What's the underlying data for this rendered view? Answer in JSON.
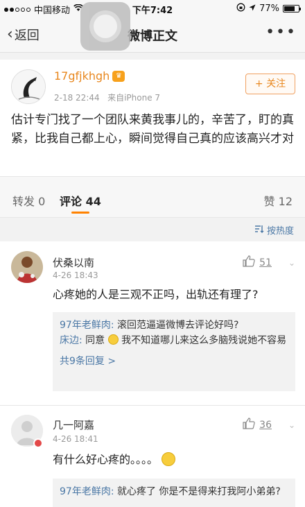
{
  "status_bar": {
    "carrier": "中国移动",
    "time": "下午7:42",
    "battery": "77%",
    "battery_level": 0.77
  },
  "nav": {
    "back_label": "返回",
    "title": "微博正文",
    "more_label": "•••"
  },
  "post": {
    "username": "17gfjkhgh",
    "time": "2-18 22:44",
    "source": "来自iPhone 7",
    "follow_label": "+ 关注",
    "content": "估计专门找了一个团队来黄我事儿的，辛苦了，盯的真紧，比我自己都上心，瞬间觉得自己真的应该高兴才对"
  },
  "tabs": {
    "repost": "转发 0",
    "comments": "评论 44",
    "likes": "赞 12"
  },
  "sort_label": "按热度",
  "comments": [
    {
      "name": "伏桑以南",
      "time": "4-26 18:43",
      "likes": "51",
      "text": "心疼她的人是三观不正吗，出轨还有理了?",
      "replies": [
        {
          "author": "97年老鲜肉:",
          "text": "滚回范逼逼微博去评论好吗?"
        },
        {
          "author": "床边:",
          "text_before": "同意",
          "text_after": "我不知道哪儿来这么多脑残说她不容易"
        }
      ],
      "more_replies": "共9条回复 >"
    },
    {
      "name": "几一阿嘉",
      "time": "4-26 18:41",
      "likes": "36",
      "text": "有什么好心疼的。。。。",
      "replies": [
        {
          "author": "97年老鲜肉:",
          "text": "就心疼了 你是不是得来打我阿小弟弟?"
        }
      ]
    }
  ],
  "colors": {
    "accent": "#ff8200",
    "username": "#e8871e",
    "link": "#4a77a5"
  }
}
